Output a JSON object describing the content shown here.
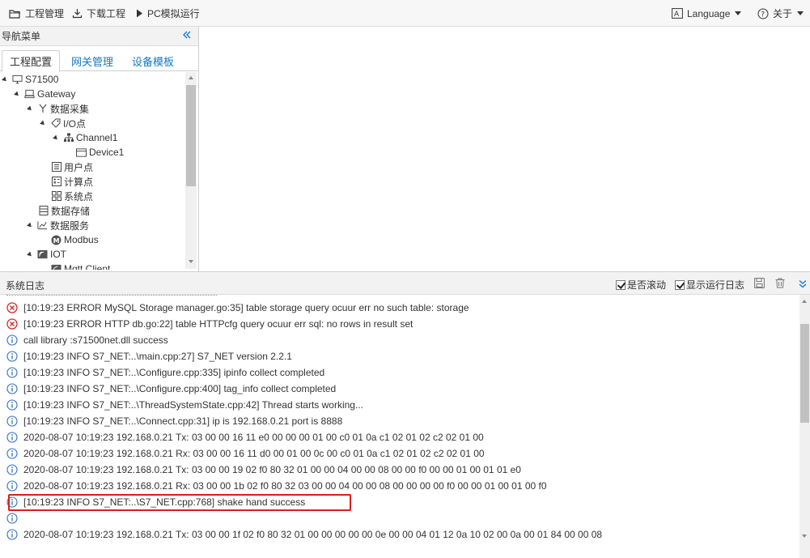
{
  "toolbar": {
    "project_manage": "工程管理",
    "download_project": "下载工程",
    "pc_simulate": "PC模拟运行",
    "language": "Language",
    "about": "关于"
  },
  "nav": {
    "title": "导航菜单",
    "tabs": [
      "工程配置",
      "网关管理",
      "设备模板"
    ]
  },
  "tree": {
    "root": "S71500",
    "gateway": "Gateway",
    "data_collect": "数据采集",
    "io_point": "I/O点",
    "channel": "Channel1",
    "device": "Device1",
    "user_point": "用户点",
    "calc_point": "计算点",
    "sys_point": "系统点",
    "data_store": "数据存储",
    "data_service": "数据服务",
    "modbus": "Modbus",
    "iot": "IOT",
    "mqtt": "Mqtt Client"
  },
  "log": {
    "title": "系统日志",
    "auto_scroll": "是否滚动",
    "show_run_log": "显示运行日志",
    "entries": [
      {
        "level": "error",
        "text": "[10:19:23 ERROR MySQL Storage manager.go:35] table storage query ocuur err no such table: storage"
      },
      {
        "level": "error",
        "text": "[10:19:23 ERROR HTTP db.go:22] table HTTPcfg query ocuur err sql: no rows in result set"
      },
      {
        "level": "info",
        "text": "call library :s71500net.dll success"
      },
      {
        "level": "info",
        "text": "[10:19:23 INFO S7_NET:..\\main.cpp:27] S7_NET version 2.2.1"
      },
      {
        "level": "info",
        "text": "[10:19:23 INFO S7_NET:..\\Configure.cpp:335] ipinfo collect completed"
      },
      {
        "level": "info",
        "text": "[10:19:23 INFO S7_NET:..\\Configure.cpp:400] tag_info collect completed"
      },
      {
        "level": "info",
        "text": "[10:19:23 INFO S7_NET:..\\ThreadSystemState.cpp:42] Thread starts working..."
      },
      {
        "level": "info",
        "text": "[10:19:23 INFO S7_NET:..\\Connect.cpp:31] ip is 192.168.0.21 port is 8888"
      },
      {
        "level": "info",
        "text": "2020-08-07 10:19:23 192.168.0.21 Tx: 03 00 00 16 11 e0 00 00 00 01 00 c0 01 0a c1 02 01 02 c2 02 01 00"
      },
      {
        "level": "info",
        "text": "2020-08-07 10:19:23 192.168.0.21 Rx: 03 00 00 16 11 d0 00 01 00 0c 00 c0 01 0a c1 02 01 02 c2 02 01 00"
      },
      {
        "level": "info",
        "text": "2020-08-07 10:19:23 192.168.0.21 Tx: 03 00 00 19 02 f0 80 32 01 00 00 04 00 00 08 00 00 f0 00 00 01 00 01 01 e0"
      },
      {
        "level": "info",
        "text": "2020-08-07 10:19:23 192.168.0.21 Rx: 03 00 00 1b 02 f0 80 32 03 00 00 04 00 00 08 00 00 00 00 f0 00 00 01 00 01 00 f0"
      },
      {
        "level": "info",
        "text": "[10:19:23 INFO S7_NET:..\\S7_NET.cpp:768] shake hand success"
      },
      {
        "level": "info",
        "text": ""
      },
      {
        "level": "info",
        "text": "2020-08-07 10:19:23 192.168.0.21 Tx: 03 00 00 1f 02 f0 80 32 01 00 00 00 00 00 0e 00 00 04 01 12 0a 10 02 00 0a 00 01 84 00 00 08"
      }
    ]
  }
}
